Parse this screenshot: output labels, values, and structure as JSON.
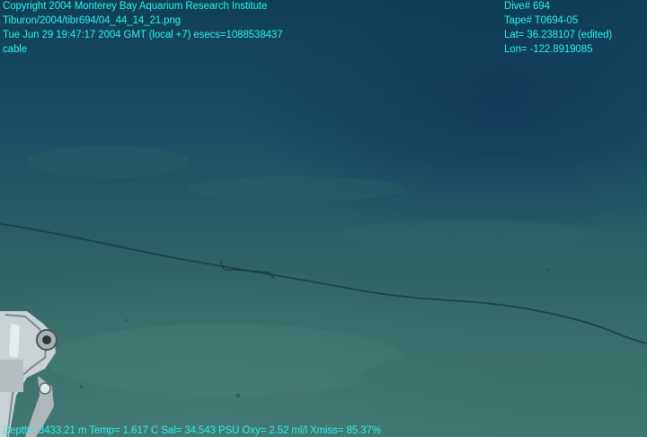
{
  "overlay": {
    "top_left": [
      "Copyright 2004 Monterey Bay Aquarium Research Institute",
      "Tiburon/2004/tibr694/04_44_14_21.png",
      "Tue Jun 29 19:47:17 2004 GMT (local +7)  esecs=1088538437",
      "cable"
    ],
    "top_right": [
      "Dive# 694",
      "Tape# T0694-05",
      "Lat= 36.238107 (edited)",
      "Lon= -122.8919085"
    ],
    "bottom": "Depth= 3433.21 m  Temp= 1.617 C  Sal= 34.543 PSU  Oxy= 2.52 ml/l  Xmiss= 85.37%"
  },
  "colors": {
    "overlay_text": "#2cf0f0",
    "water_top": "#103f58",
    "seafloor": "#3f7670"
  }
}
